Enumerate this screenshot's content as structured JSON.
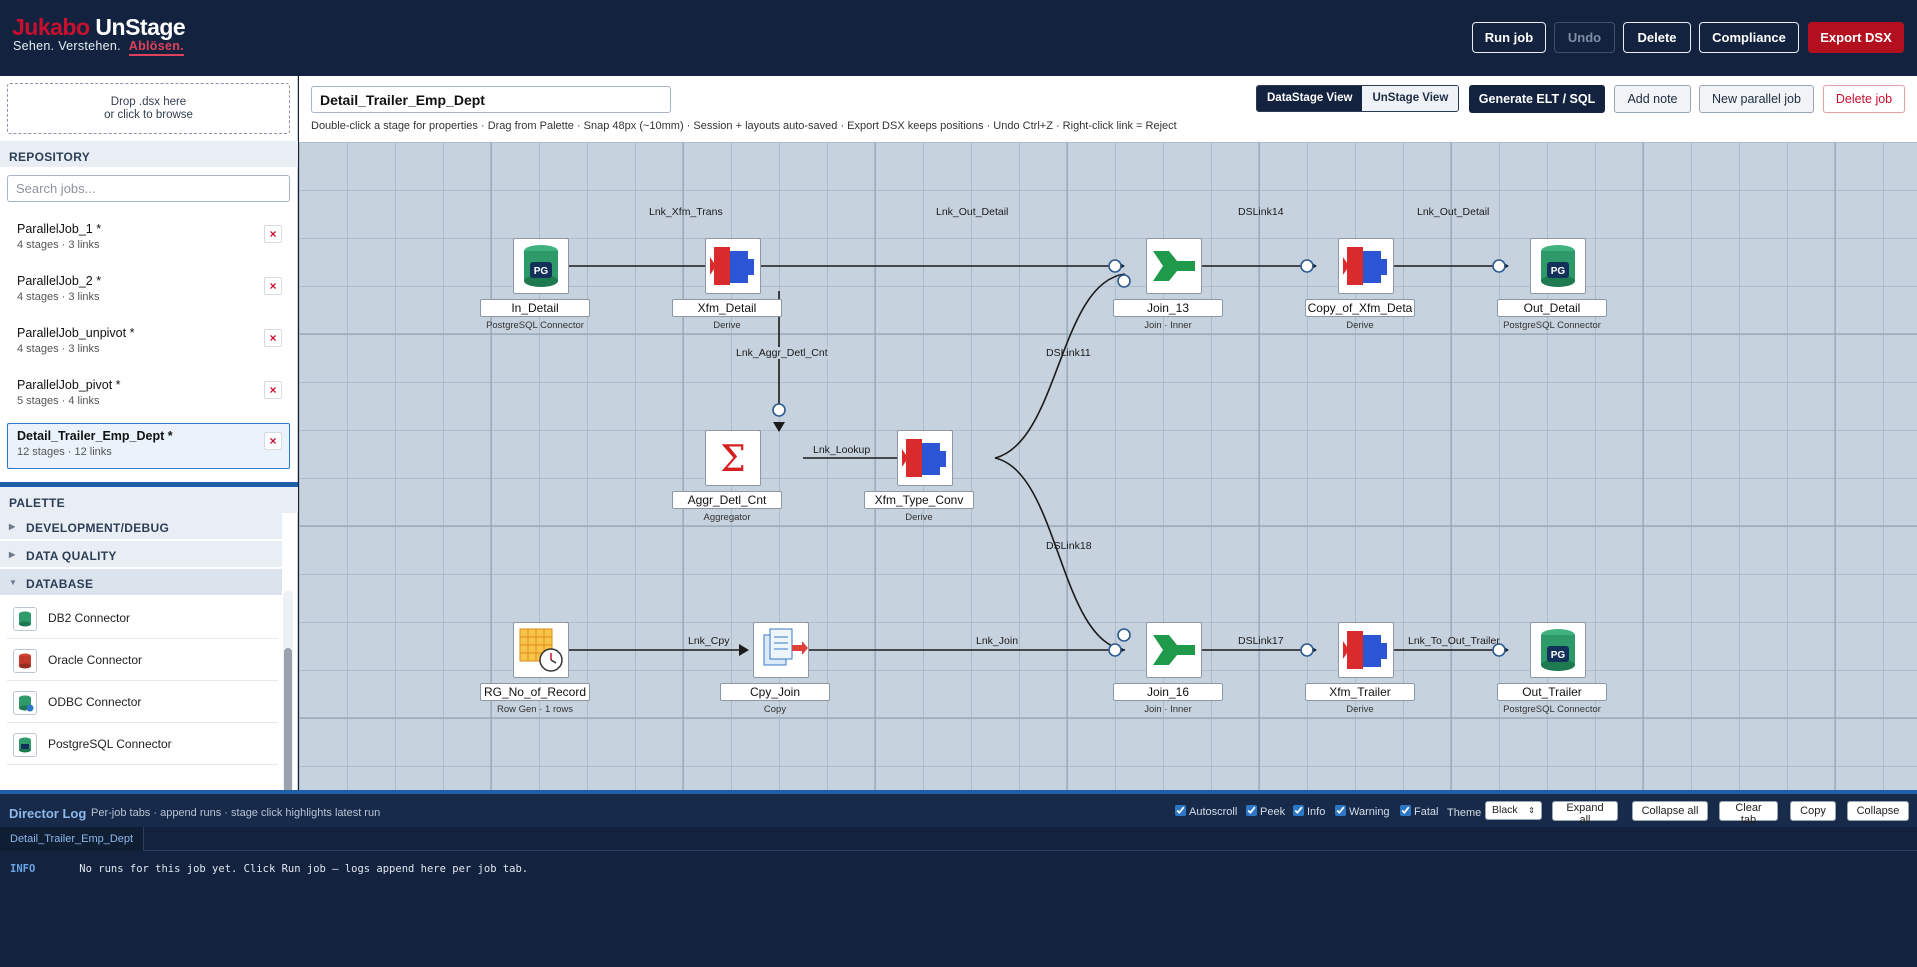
{
  "header": {
    "logo_part1": "Jukabo",
    "logo_part2": "UnStage",
    "tagline": "Sehen. Verstehen.",
    "tagline_accent": "Ablösen.",
    "run_job": "Run job",
    "undo": "Undo",
    "delete": "Delete",
    "compliance": "Compliance",
    "export_dsx": "Export DSX"
  },
  "sidebar": {
    "drop_line1": "Drop .dsx here",
    "drop_line2": "or click to browse",
    "repository_title": "REPOSITORY",
    "search_placeholder": "Search jobs...",
    "delete_icon": "×",
    "jobs": [
      {
        "name": "ParallelJob_1 *",
        "stats": "4 stages · 3 links"
      },
      {
        "name": "ParallelJob_2 *",
        "stats": "4 stages · 3 links"
      },
      {
        "name": "ParallelJob_unpivot *",
        "stats": "4 stages · 3 links"
      },
      {
        "name": "ParallelJob_pivot *",
        "stats": "5 stages · 4 links"
      },
      {
        "name": "Detail_Trailer_Emp_Dept *",
        "stats": "12 stages · 12 links"
      }
    ],
    "palette_title": "PALETTE",
    "categories": [
      {
        "name": "DEVELOPMENT/DEBUG",
        "expanded": false
      },
      {
        "name": "DATA QUALITY",
        "expanded": false
      },
      {
        "name": "DATABASE",
        "expanded": true
      }
    ],
    "palette_items": [
      "DB2 Connector",
      "Oracle Connector",
      "ODBC Connector",
      "PostgreSQL Connector"
    ]
  },
  "toolbar": {
    "job_name": "Detail_Trailer_Emp_Dept",
    "hint": "Double-click a stage for properties · Drag from Palette · Snap 48px (~10mm) · Session + layouts auto-saved · Export DSX keeps positions · Undo Ctrl+Z · Right-click link = Reject",
    "datastage_view": "DataStage View",
    "unstage_view": "UnStage View",
    "generate": "Generate ELT / SQL",
    "add_note": "Add note",
    "new_job": "New parallel job",
    "delete_job": "Delete job"
  },
  "stages": [
    {
      "name": "In_Detail",
      "sub": "PostgreSQL Connector",
      "icon": "postgresql-icon"
    },
    {
      "name": "Xfm_Detail",
      "sub": "Derive",
      "icon": "transformer-icon"
    },
    {
      "name": "Join_13",
      "sub": "Join · Inner",
      "icon": "join-icon"
    },
    {
      "name": "Copy_of_Xfm_Deta",
      "sub": "Derive",
      "icon": "transformer-icon"
    },
    {
      "name": "Out_Detail",
      "sub": "PostgreSQL Connector",
      "icon": "postgresql-icon"
    },
    {
      "name": "Aggr_Detl_Cnt",
      "sub": "Aggregator",
      "icon": "aggregator-icon"
    },
    {
      "name": "Xfm_Type_Conv",
      "sub": "Derive",
      "icon": "transformer-icon"
    },
    {
      "name": "RG_No_of_Record",
      "sub": "Row Gen · 1 rows",
      "icon": "row-generator-icon"
    },
    {
      "name": "Cpy_Join",
      "sub": "Copy",
      "icon": "copy-icon"
    },
    {
      "name": "Join_16",
      "sub": "Join · Inner",
      "icon": "join-icon"
    },
    {
      "name": "Xfm_Trailer",
      "sub": "Derive",
      "icon": "transformer-icon"
    },
    {
      "name": "Out_Trailer",
      "sub": "PostgreSQL Connector",
      "icon": "postgresql-icon"
    }
  ],
  "links": [
    "Lnk_Xfm_Trans",
    "Lnk_Out_Detail",
    "DSLink14",
    "Lnk_Out_Detail",
    "Lnk_Aggr_Detl_Cnt",
    "DSLink11",
    "Lnk_Lookup",
    "DSLink18",
    "Lnk_Cpy",
    "Lnk_Join",
    "DSLink17",
    "Lnk_To_Out_Trailer"
  ],
  "pg_label": "PG",
  "log": {
    "title": "Director Log",
    "subtitle": "Per-job tabs · append runs · stage click highlights latest run",
    "autoscroll": "Autoscroll",
    "peek": "Peek",
    "info": "Info",
    "warning": "Warning",
    "fatal": "Fatal",
    "theme_label": "Theme",
    "theme_value": "Black",
    "expand_all": "Expand all",
    "collapse_all": "Collapse all",
    "clear_tab": "Clear tab",
    "copy": "Copy",
    "collapse": "Collapse",
    "tab": "Detail_Trailer_Emp_Dept",
    "level": "INFO",
    "message": "No runs for this job yet. Click Run job — logs append here per job tab."
  },
  "colors": {
    "brand_red": "#c8102e",
    "navy": "#13233f",
    "accent_blue": "#1f5fa8"
  }
}
